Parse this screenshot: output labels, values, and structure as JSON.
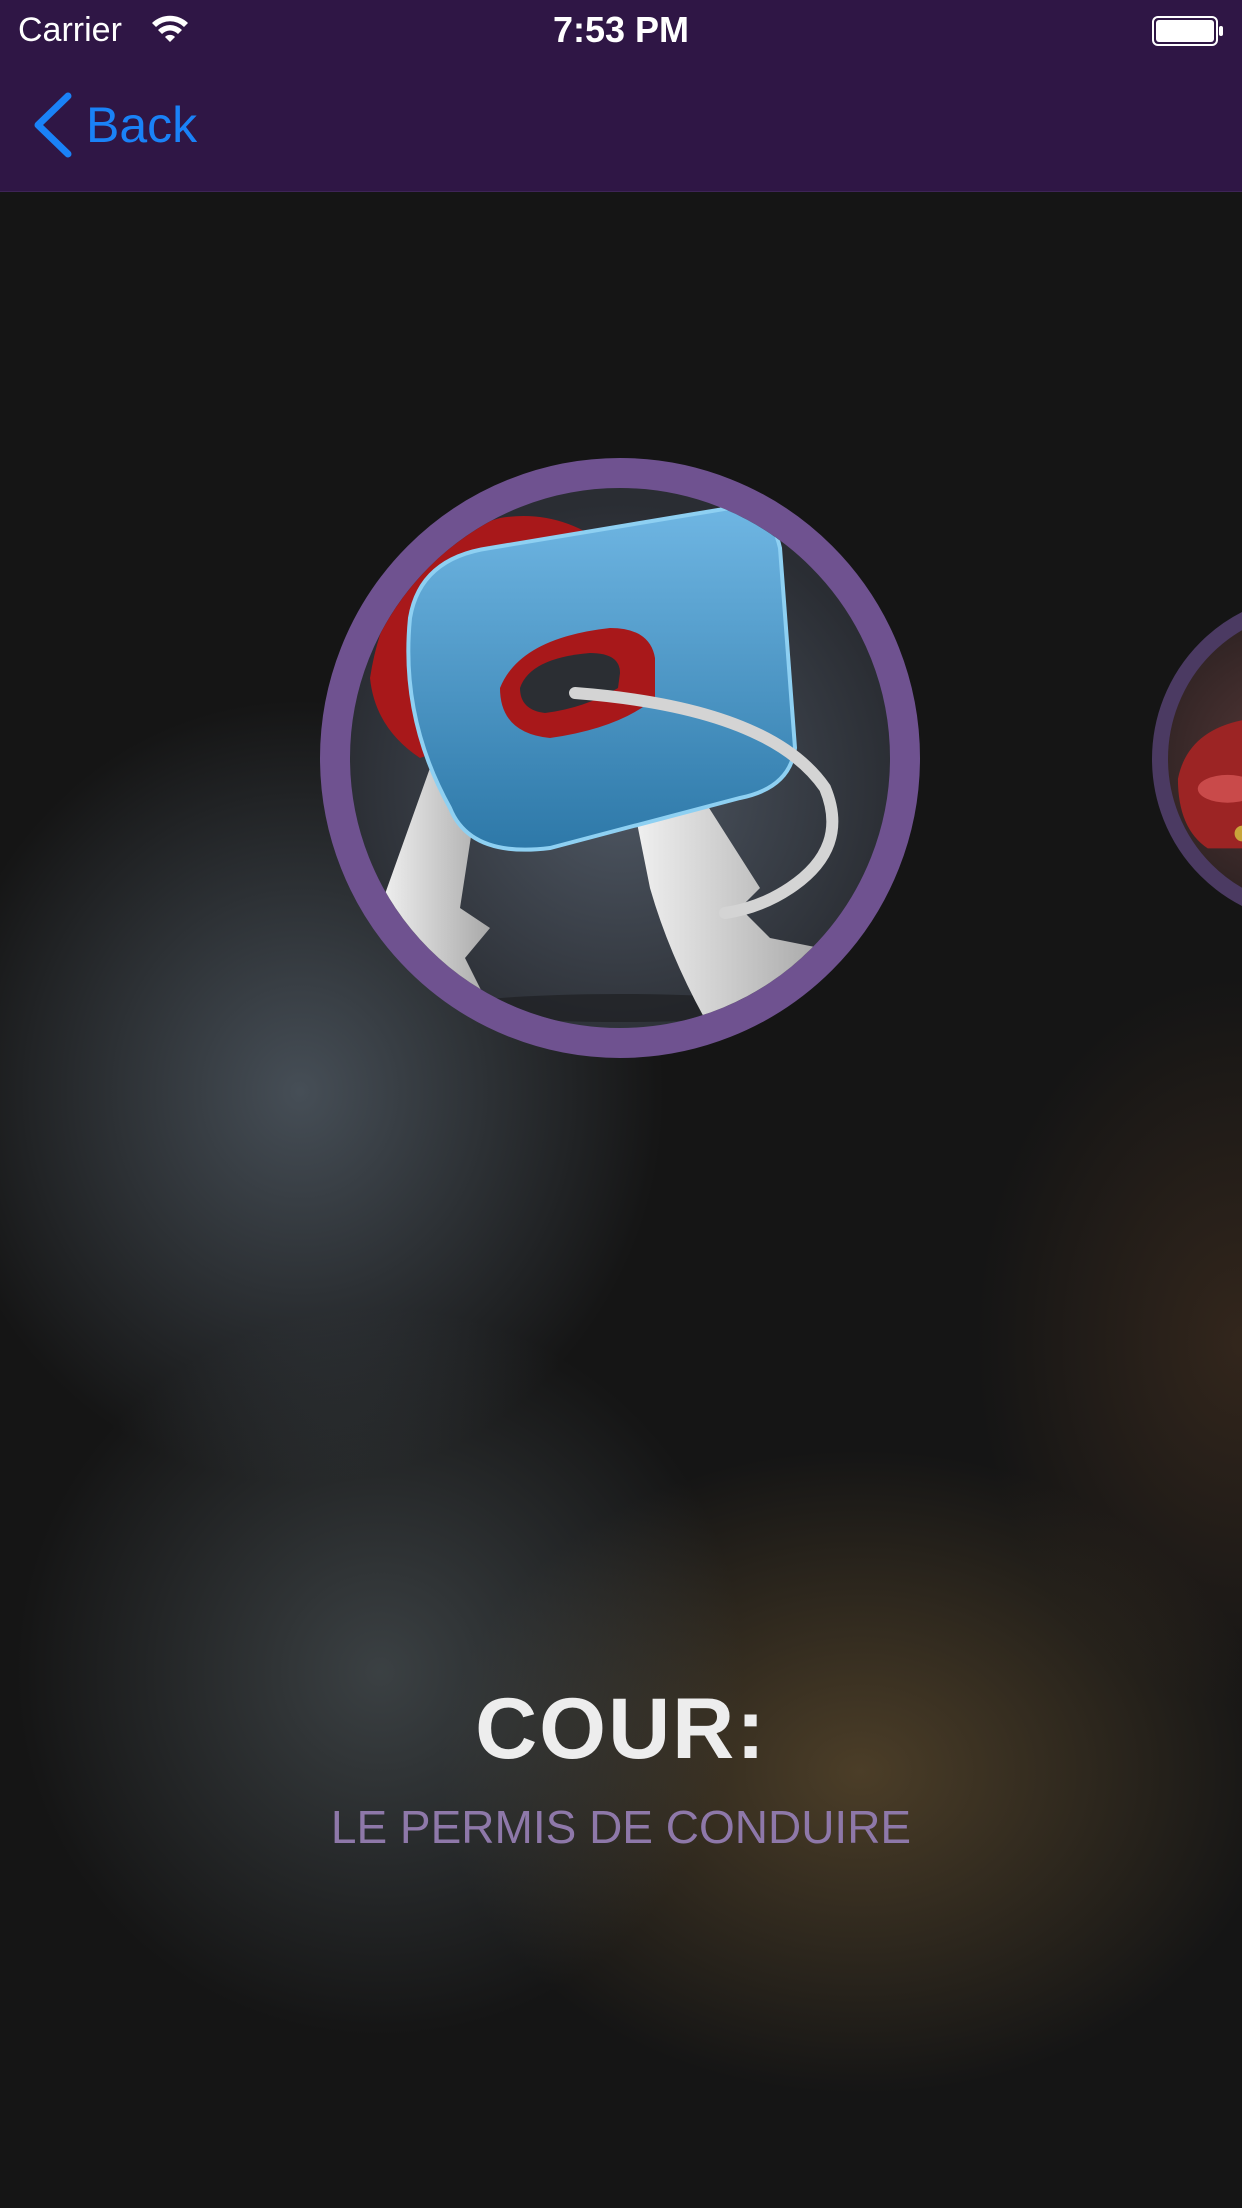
{
  "status_bar": {
    "carrier": "Carrier",
    "time": "7:53 PM",
    "wifi_icon": "wifi-icon",
    "battery_icon": "battery-icon"
  },
  "nav": {
    "back_label": "Back",
    "back_icon": "chevron-left-icon",
    "accent_color": "#1a82f7",
    "bar_color": "#2f1645"
  },
  "carousel": {
    "current": {
      "image": "car-keys-image",
      "ring_color": "#6f5290"
    },
    "next": {
      "image": "red-car-image"
    }
  },
  "course": {
    "title": "COUR:",
    "subtitle": "LE PERMIS DE CONDUIRE",
    "subtitle_color": "#8e78a9"
  }
}
